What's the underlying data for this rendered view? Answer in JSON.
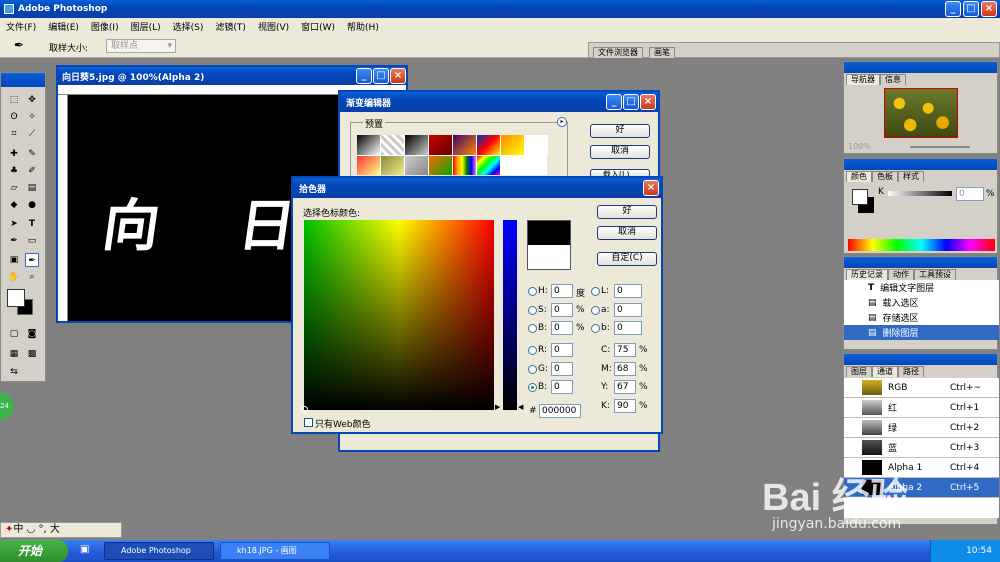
{
  "app": {
    "title": "Adobe Photoshop"
  },
  "menu": [
    "文件(F)",
    "编辑(E)",
    "图像(I)",
    "图层(L)",
    "选择(S)",
    "滤镜(T)",
    "视图(V)",
    "窗口(W)",
    "帮助(H)"
  ],
  "options": {
    "sample_label": "取样大小:",
    "sample_value": "取样点"
  },
  "palette_well": {
    "tabs": [
      "文件浏览器",
      "画笔"
    ]
  },
  "document": {
    "title": "向日葵5.jpg @ 100%(Alpha 2)",
    "text": "向 日"
  },
  "gradient_editor": {
    "title": "渐变编辑器",
    "presets_label": "预置",
    "ok": "好",
    "cancel": "取消",
    "load": "载入(L)..."
  },
  "color_picker": {
    "title": "拾色器",
    "heading": "选择色标颜色:",
    "ok": "好",
    "cancel": "取消",
    "custom": "自定(C)",
    "web_only": "只有Web颜色",
    "hex_label": "#",
    "hex": "000000",
    "hsb": [
      {
        "label": "H:",
        "value": "0",
        "unit": "度"
      },
      {
        "label": "S:",
        "value": "0",
        "unit": "%"
      },
      {
        "label": "B:",
        "value": "0",
        "unit": "%"
      }
    ],
    "rgb": [
      {
        "label": "R:",
        "value": "0"
      },
      {
        "label": "G:",
        "value": "0"
      },
      {
        "label": "B:",
        "value": "0"
      }
    ],
    "lab": [
      {
        "label": "L:",
        "value": "0"
      },
      {
        "label": "a:",
        "value": "0"
      },
      {
        "label": "b:",
        "value": "0"
      }
    ],
    "cmyk": [
      {
        "label": "C:",
        "value": "75",
        "unit": "%"
      },
      {
        "label": "M:",
        "value": "68",
        "unit": "%"
      },
      {
        "label": "Y:",
        "value": "67",
        "unit": "%"
      },
      {
        "label": "K:",
        "value": "90",
        "unit": "%"
      }
    ]
  },
  "navigator": {
    "tabs": [
      "导航器",
      "信息"
    ],
    "zoom": "100%"
  },
  "color_palette": {
    "tabs": [
      "颜色",
      "色板",
      "样式"
    ],
    "k_label": "K",
    "k_value": "0",
    "k_unit": "%"
  },
  "history": {
    "tabs": [
      "历史记录",
      "动作",
      "工具预设"
    ],
    "items": [
      "编辑文字图层",
      "载入选区",
      "存储选区",
      "删除图层"
    ]
  },
  "channels": {
    "tabs": [
      "图层",
      "通道",
      "路径"
    ],
    "items": [
      {
        "name": "RGB",
        "shortcut": "Ctrl+~"
      },
      {
        "name": "红",
        "shortcut": "Ctrl+1"
      },
      {
        "name": "绿",
        "shortcut": "Ctrl+2"
      },
      {
        "name": "蓝",
        "shortcut": "Ctrl+3"
      },
      {
        "name": "Alpha 1",
        "shortcut": "Ctrl+4"
      },
      {
        "name": "Alpha 2",
        "shortcut": "Ctrl+5"
      }
    ]
  },
  "ime": {
    "text": "中 ◡ °, 大"
  },
  "taskbar": {
    "start": "开始",
    "items": [
      "Adobe Photoshop",
      "kh18.JPG - 画图"
    ],
    "clock": "10:54"
  },
  "watermark": {
    "brand": "Bai 经验",
    "url": "jingyan.baidu.com"
  },
  "colors": {
    "xp_blue": "#0346b8",
    "selection": "#316ac5"
  }
}
